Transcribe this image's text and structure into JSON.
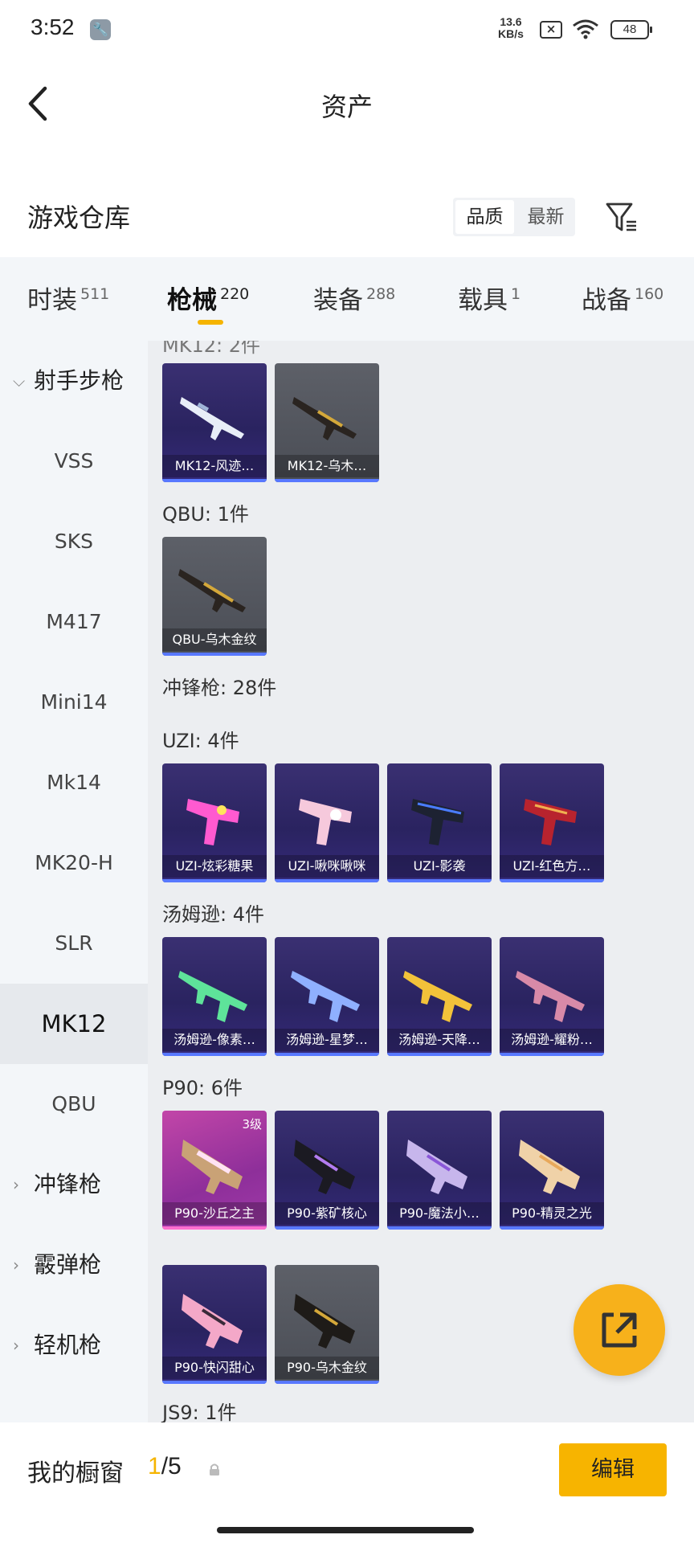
{
  "status_bar": {
    "time": "3:52",
    "net_speed_value": "13.6",
    "net_speed_unit": "KB/s",
    "battery": "48"
  },
  "header": {
    "title": "资产",
    "back_icon": "chevron-left-icon"
  },
  "warehouse": {
    "title": "游戏仓库",
    "sort_options": [
      "品质",
      "最新"
    ],
    "sort_active": "品质",
    "filter_icon": "filter-icon"
  },
  "tabs": [
    {
      "label": "时装",
      "count": "511"
    },
    {
      "label": "枪械",
      "count": "220",
      "active": true
    },
    {
      "label": "装备",
      "count": "288"
    },
    {
      "label": "载具",
      "count": "1"
    },
    {
      "label": "战备",
      "count": "160"
    }
  ],
  "sidebar": [
    {
      "label": "射手步枪",
      "type": "group",
      "expanded": true
    },
    {
      "label": "VSS"
    },
    {
      "label": "SKS"
    },
    {
      "label": "M417"
    },
    {
      "label": "Mini14"
    },
    {
      "label": "Mk14"
    },
    {
      "label": "MK20-H"
    },
    {
      "label": "SLR"
    },
    {
      "label": "MK12",
      "active": true
    },
    {
      "label": "QBU"
    },
    {
      "label": "冲锋枪",
      "type": "group"
    },
    {
      "label": "霰弹枪",
      "type": "group"
    },
    {
      "label": "轻机枪",
      "type": "group"
    }
  ],
  "content": {
    "partial_top_label": "MK12: 2件",
    "groups": {
      "qbu": "QBU: 1件",
      "smg": "冲锋枪: 28件",
      "uzi": "UZI: 4件",
      "tommy": "汤姆逊: 4件",
      "p90": "P90: 6件",
      "js9": "JS9: 1件"
    },
    "items": {
      "mk12": [
        {
          "name": "MK12-风迹…",
          "style": "purple"
        },
        {
          "name": "MK12-乌木…",
          "style": "gray"
        }
      ],
      "qbu": [
        {
          "name": "QBU-乌木金纹",
          "style": "gray"
        }
      ],
      "uzi": [
        {
          "name": "UZI-炫彩糖果",
          "style": "purple"
        },
        {
          "name": "UZI-啾咪啾咪",
          "style": "purple"
        },
        {
          "name": "UZI-影袭",
          "style": "purple"
        },
        {
          "name": "UZI-红色方…",
          "style": "purple"
        }
      ],
      "tommy": [
        {
          "name": "汤姆逊-像素…",
          "style": "purple"
        },
        {
          "name": "汤姆逊-星梦…",
          "style": "purple"
        },
        {
          "name": "汤姆逊-天降…",
          "style": "purple"
        },
        {
          "name": "汤姆逊-耀粉…",
          "style": "purple"
        }
      ],
      "p90": [
        {
          "name": "P90-沙丘之主",
          "style": "pink",
          "level": "3级"
        },
        {
          "name": "P90-紫矿核心",
          "style": "purple"
        },
        {
          "name": "P90-魔法小…",
          "style": "purple"
        },
        {
          "name": "P90-精灵之光",
          "style": "purple"
        },
        {
          "name": "P90-快闪甜心",
          "style": "purple"
        },
        {
          "name": "P90-乌木金纹",
          "style": "gray"
        }
      ]
    }
  },
  "fab": {
    "icon": "external-link-icon"
  },
  "bottom_bar": {
    "label": "我的橱窗",
    "current": "1",
    "total": "/5",
    "lock_icon": "lock-icon",
    "edit_label": "编辑"
  },
  "colors": {
    "accent": "#f5b400",
    "card_purple": "#2a2360",
    "card_gray": "#4a4d55",
    "card_pink": "#8e2f9a"
  }
}
